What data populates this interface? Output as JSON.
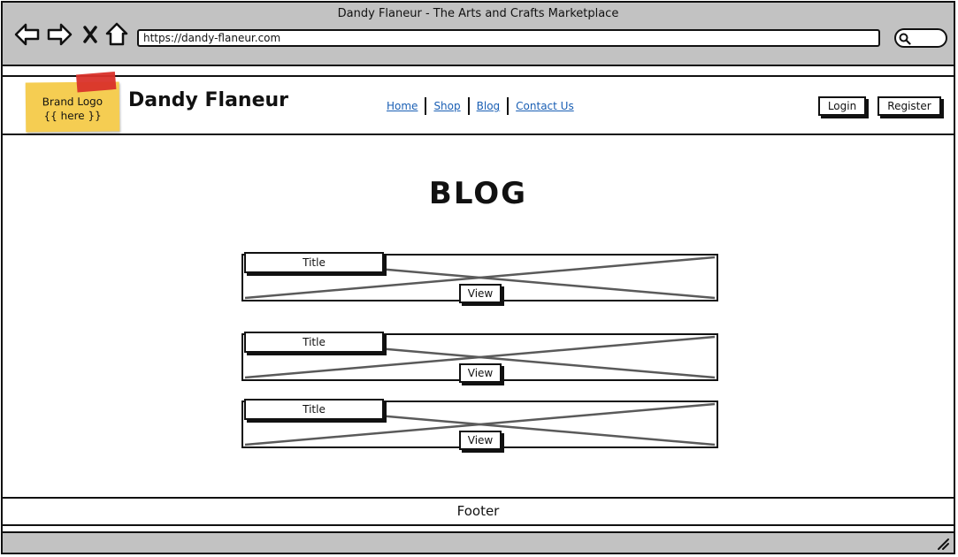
{
  "browser": {
    "window_title": "Dandy Flaneur - The Arts and Crafts Marketplace",
    "url": "https://dandy-flaneur.com",
    "icons": [
      "back-arrow-icon",
      "forward-arrow-icon",
      "close-x-icon",
      "home-icon",
      "search-icon",
      "resize-grip-icon"
    ]
  },
  "header": {
    "logo_line1": "Brand Logo",
    "logo_line2": "{{ here }}",
    "site_name": "Dandy Flaneur",
    "nav": [
      {
        "label": "Home"
      },
      {
        "label": "Shop"
      },
      {
        "label": "Blog"
      },
      {
        "label": "Contact Us"
      }
    ],
    "login_label": "Login",
    "register_label": "Register"
  },
  "main": {
    "page_title": "BLOG",
    "posts": [
      {
        "title": "Title",
        "view_label": "View"
      },
      {
        "title": "Title",
        "view_label": "View"
      },
      {
        "title": "Title",
        "view_label": "View"
      }
    ]
  },
  "footer": {
    "label": "Footer"
  },
  "colors": {
    "chrome": "#c2c2c2",
    "link": "#1a5fb4",
    "sticky_note": "#f5cd52",
    "tape": "#d9312a",
    "placeholder_cross": "#5a5a5a"
  }
}
